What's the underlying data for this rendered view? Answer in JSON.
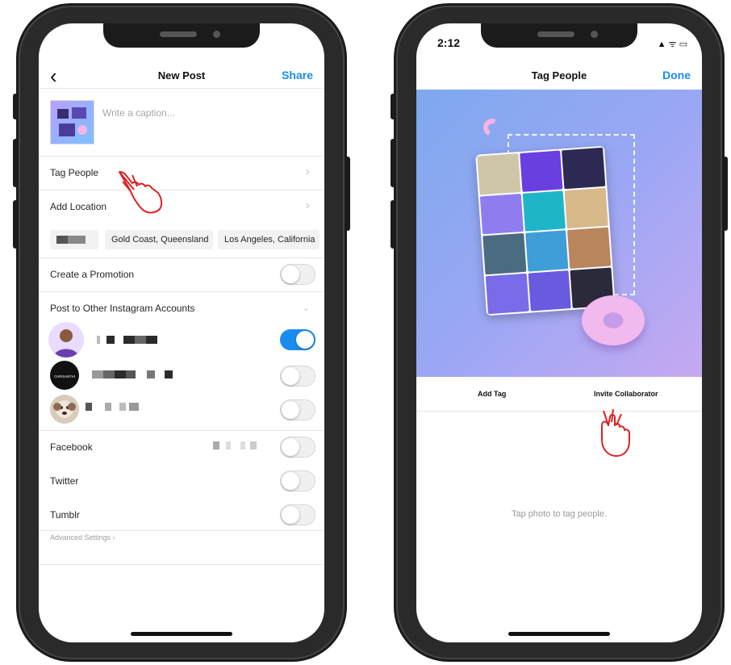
{
  "new_post": {
    "title": "New Post",
    "share_label": "Share",
    "back_glyph": "‹",
    "caption_placeholder": "Write a caption...",
    "rows": {
      "tag_people": "Tag People",
      "add_location": "Add Location",
      "create_promotion": "Create a Promotion",
      "post_other_accounts": "Post to Other Instagram Accounts",
      "facebook": "Facebook",
      "twitter": "Twitter",
      "tumblr": "Tumblr"
    },
    "location_chips": [
      "Gold Coast, Queensland",
      "Los Angeles, California"
    ],
    "avatar_text": "CHRISANTHI",
    "advanced_settings": "Advanced Settings ›",
    "toggles": {
      "create_promotion": false,
      "account_1": true,
      "account_2": false,
      "account_3": false,
      "facebook": false,
      "twitter": false,
      "tumblr": false
    },
    "accent_color": "#1a8cf0"
  },
  "tag_people": {
    "status_time": "2:12",
    "status_icons": "▲ ᯤ ▭",
    "title": "Tag People",
    "done_label": "Done",
    "tabs": {
      "add_tag": "Add Tag",
      "invite_collaborator": "Invite Collaborator"
    },
    "hint": "Tap photo to tag people."
  },
  "icons": [
    "back-chevron-icon",
    "chevron-right-icon",
    "chevron-down-icon",
    "pointer-hand-icon",
    "location-arrow-icon",
    "signal-icon",
    "wifi-icon",
    "battery-icon"
  ]
}
